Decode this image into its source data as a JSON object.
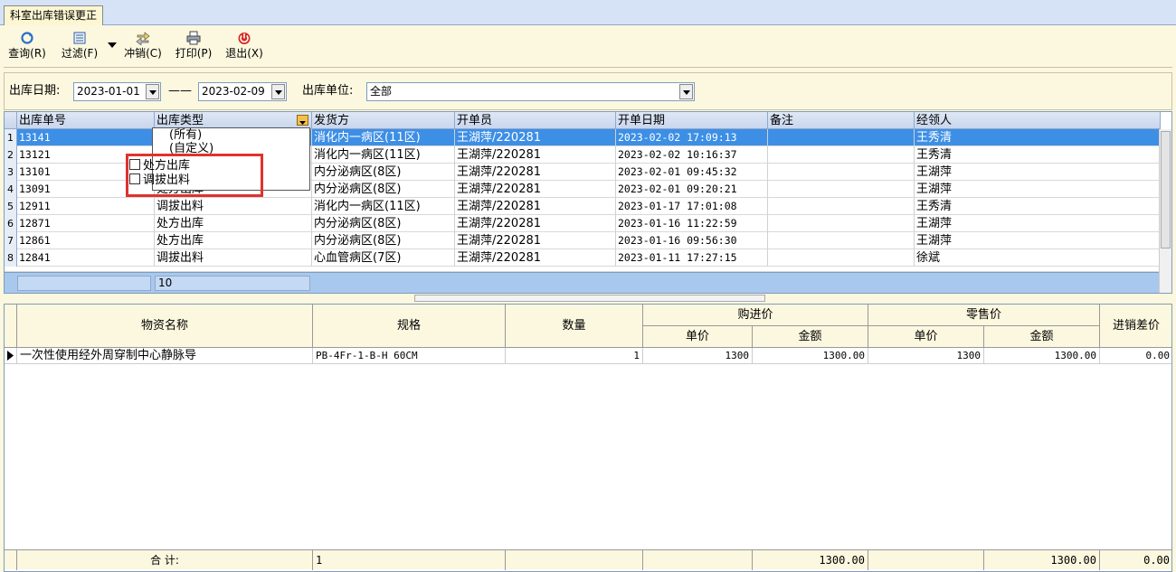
{
  "window": {
    "tab_title": "科室出库错误更正"
  },
  "toolbar": {
    "query": "查询(R)",
    "filter": "过滤(F)",
    "offset": "冲销(C)",
    "print": "打印(P)",
    "exit": "退出(X)"
  },
  "filter_bar": {
    "date_label": "出库日期:",
    "date_from": "2023-01-01",
    "date_sep": "——",
    "date_to": "2023-02-09",
    "unit_label": "出库单位:",
    "unit_value": "全部"
  },
  "top_grid": {
    "columns": [
      "出库单号",
      "出库类型",
      "发货方",
      "开单员",
      "开单日期",
      "备注",
      "经领人"
    ],
    "rows": [
      {
        "no": "1",
        "id": "13141",
        "type": "",
        "from": "消化内一病区(11区)",
        "clerk": "王湖萍/220281",
        "date": "2023-02-02 17:09:13",
        "note": "",
        "receiver": "王秀清"
      },
      {
        "no": "2",
        "id": "13121",
        "type": "",
        "from": "消化内一病区(11区)",
        "clerk": "王湖萍/220281",
        "date": "2023-02-02 10:16:37",
        "note": "",
        "receiver": "王秀清"
      },
      {
        "no": "3",
        "id": "13101",
        "type": "",
        "from": "内分泌病区(8区)",
        "clerk": "王湖萍/220281",
        "date": "2023-02-01 09:45:32",
        "note": "",
        "receiver": "王湖萍"
      },
      {
        "no": "4",
        "id": "13091",
        "type": "处方出库",
        "from": "内分泌病区(8区)",
        "clerk": "王湖萍/220281",
        "date": "2023-02-01 09:20:21",
        "note": "",
        "receiver": "王湖萍"
      },
      {
        "no": "5",
        "id": "12911",
        "type": "调拔出料",
        "from": "消化内一病区(11区)",
        "clerk": "王湖萍/220281",
        "date": "2023-01-17 17:01:08",
        "note": "",
        "receiver": "王秀清"
      },
      {
        "no": "6",
        "id": "12871",
        "type": "处方出库",
        "from": "内分泌病区(8区)",
        "clerk": "王湖萍/220281",
        "date": "2023-01-16 11:22:59",
        "note": "",
        "receiver": "王湖萍"
      },
      {
        "no": "7",
        "id": "12861",
        "type": "处方出库",
        "from": "内分泌病区(8区)",
        "clerk": "王湖萍/220281",
        "date": "2023-01-16 09:56:30",
        "note": "",
        "receiver": "王湖萍"
      },
      {
        "no": "8",
        "id": "12841",
        "type": "调拔出料",
        "from": "心血管病区(7区)",
        "clerk": "王湖萍/220281",
        "date": "2023-01-11 17:27:15",
        "note": "",
        "receiver": "徐斌"
      }
    ],
    "footer_count": "10"
  },
  "type_dropdown": {
    "items": [
      "(所有)",
      "(自定义)",
      "处方出库",
      "调拔出料"
    ]
  },
  "bottom_grid": {
    "headers": {
      "name": "物资名称",
      "spec": "规格",
      "qty": "数量",
      "purchase": "购进价",
      "retail": "零售价",
      "unit_price": "单价",
      "amount": "金额",
      "diff": "进销差价"
    },
    "rows": [
      {
        "name": "一次性使用经外周穿制中心静脉导",
        "spec": "PB-4Fr-1-B-H  60CM",
        "qty": "1",
        "p_price": "1300",
        "p_amount": "1300.00",
        "r_price": "1300",
        "r_amount": "1300.00",
        "diff": "0.00"
      }
    ],
    "footer": {
      "label": "合  计:",
      "qty": "1",
      "p_amount": "1300.00",
      "r_amount": "1300.00",
      "diff": "0.00"
    }
  },
  "colors": {
    "panel_bg": "#fcf7df",
    "selected_row": "#3d8fe6",
    "highlight_box": "#e0322c"
  }
}
